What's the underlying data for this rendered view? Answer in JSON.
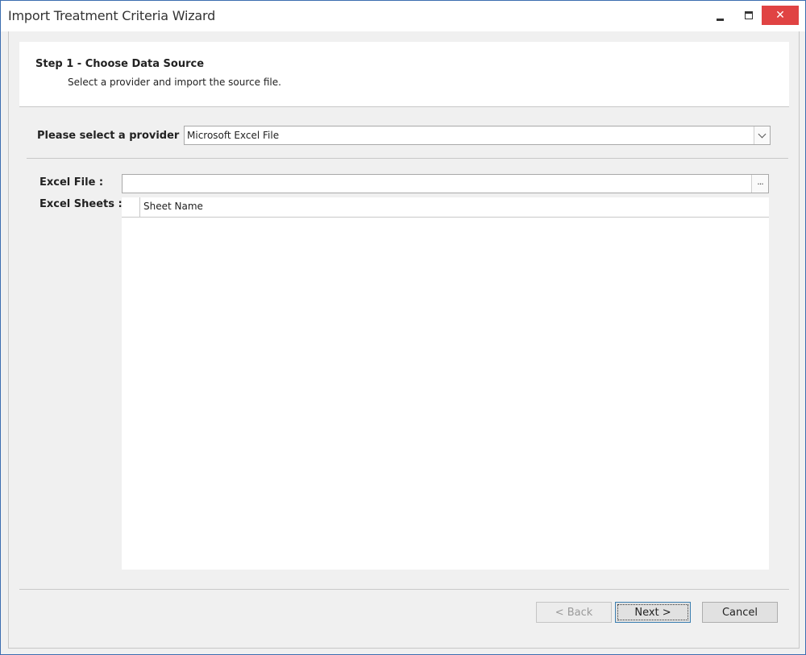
{
  "window": {
    "title": "Import Treatment Criteria Wizard",
    "controls": {
      "minimize": "minimize",
      "maximize": "maximize",
      "close": "✕"
    }
  },
  "header": {
    "step_title": "Step 1 - Choose Data Source",
    "step_description": "Select a provider and import the source file."
  },
  "provider": {
    "label": "Please select a provider :",
    "selected_value": "Microsoft Excel File"
  },
  "excel_file": {
    "label": "Excel File :",
    "value": "",
    "browse_label": "···"
  },
  "excel_sheets": {
    "label": "Excel Sheets :",
    "columns": [
      "Sheet Name"
    ],
    "rows": []
  },
  "footer": {
    "back_label": "< Back",
    "next_label": "Next >",
    "cancel_label": "Cancel"
  },
  "colors": {
    "close_button": "#e04343",
    "window_border": "#3c6db0",
    "background": "#f0f0f0"
  }
}
